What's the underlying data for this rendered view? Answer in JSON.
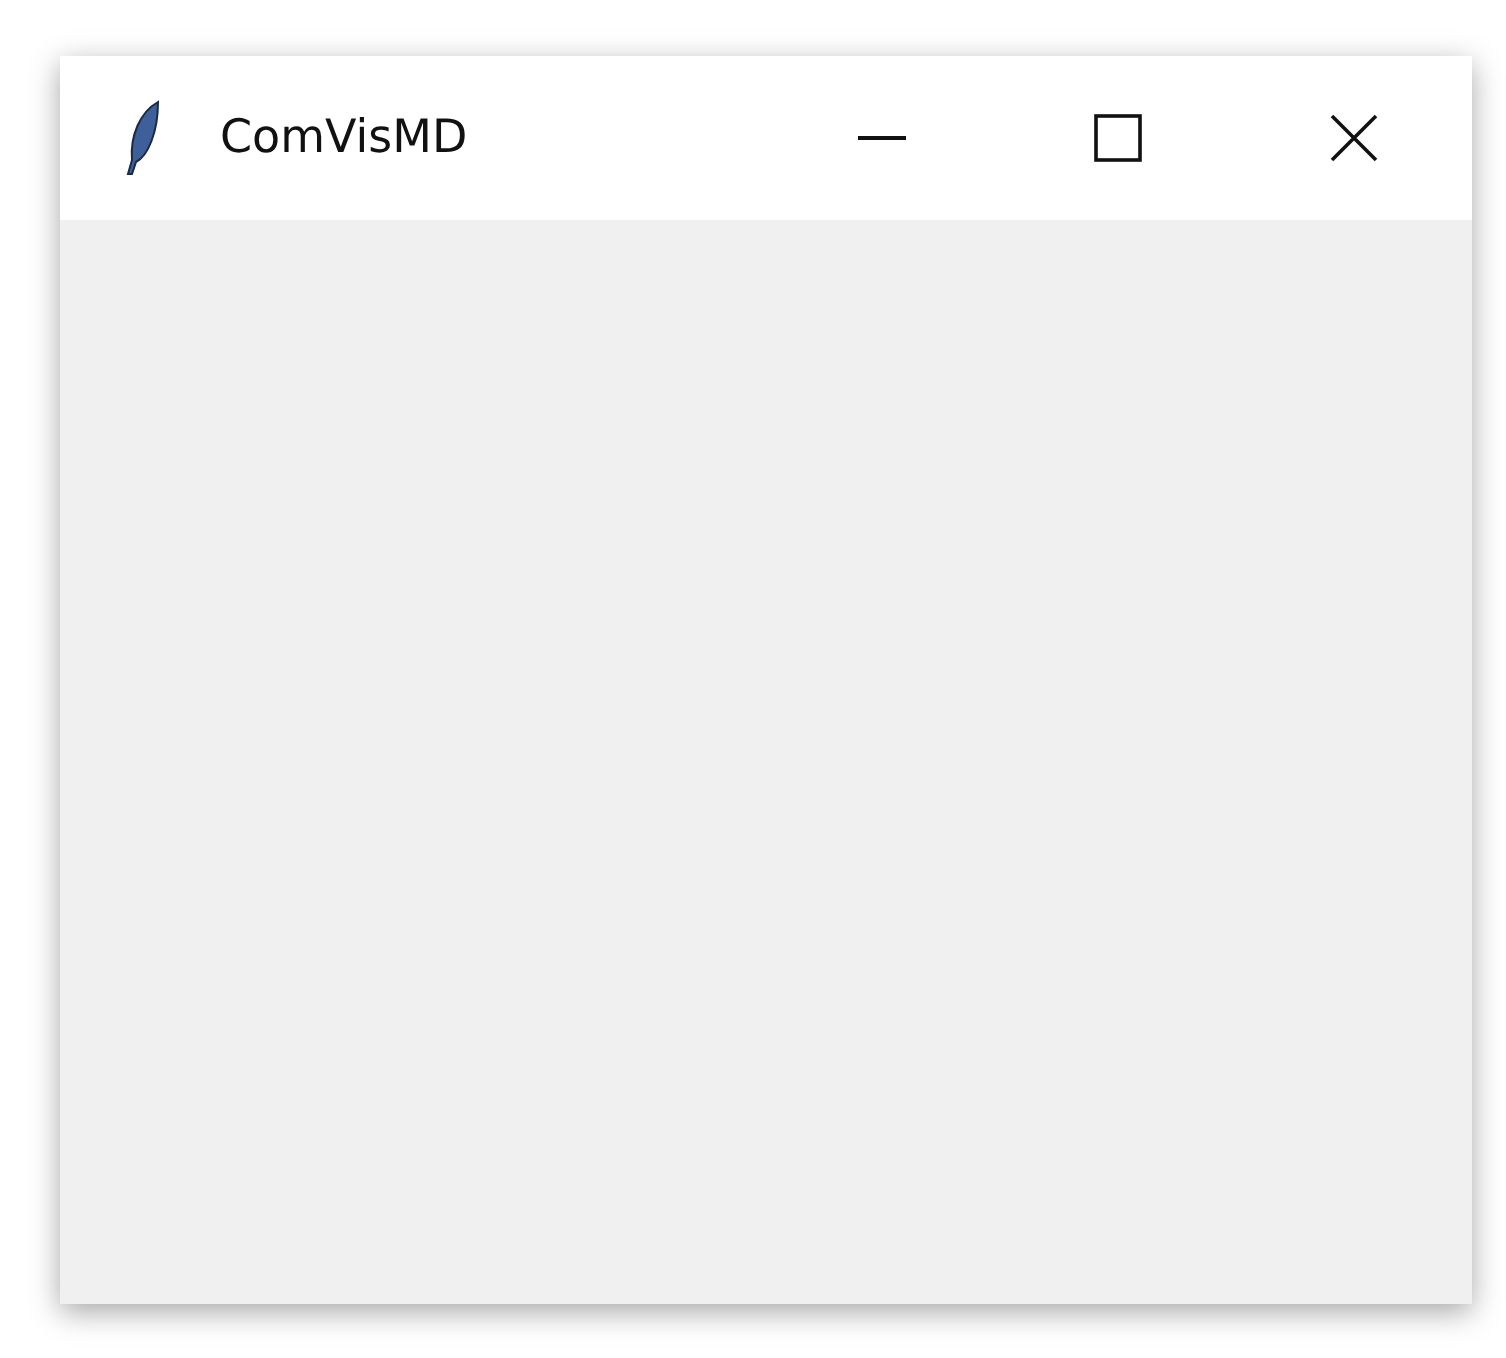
{
  "window": {
    "title": "ComVisMD"
  }
}
